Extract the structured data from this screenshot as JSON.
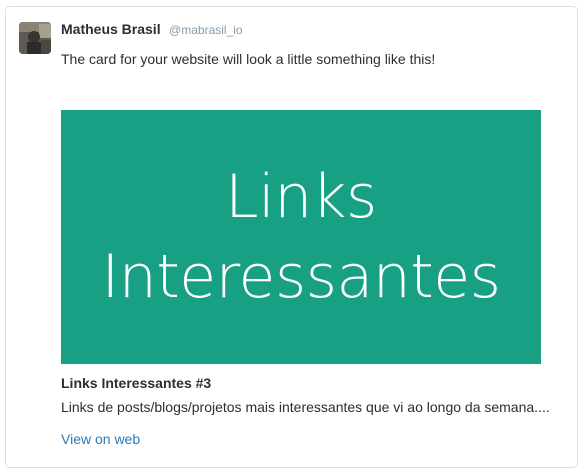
{
  "tweet": {
    "author_name": "Matheus Brasil",
    "author_handle": "@mabrasil_io",
    "text": "The card for your website will look a little something like this!"
  },
  "card": {
    "image_text_line1": "Links",
    "image_text_line2": "Interessantes",
    "image_bg_color": "#18a085",
    "title": "Links Interessantes #3",
    "description": "Links de posts/blogs/projetos mais interessantes que vi ao longo da semana....",
    "link_label": "View on web"
  },
  "colors": {
    "link": "#2b7bb9",
    "text": "#292f33",
    "handle": "#8899a6"
  }
}
